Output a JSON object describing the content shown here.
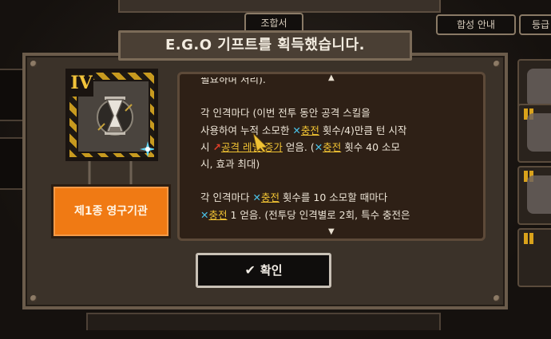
{
  "background": {
    "top_chip": "조합서",
    "synthesis_guide": "합성 안내",
    "grade_chip": "등급"
  },
  "dialog": {
    "title": "E.G.O 기프트를 획득했습니다.",
    "gift": {
      "tier": "IV",
      "name": "제1종 영구기관",
      "icon": "hourglass-icon"
    },
    "description": {
      "cut_line": "필요하며 처리).",
      "para1": {
        "line1": "각 인격마다 (이번 전투 동안 공격 스킬을",
        "line2": "사용하여 누적 소모한 ",
        "charge": "충전",
        "line2_rest": " 횟수/4)만큼 턴 시작",
        "line3_pre": "시 ",
        "attack_level_up": "공격 레벨 증가",
        "line3_mid": " 얻음. (",
        "line3_rest": " 횟수 40 소모",
        "line4": "시, 효과 최대)"
      },
      "para2": {
        "line1_pre": "각 인격마다 ",
        "line1_rest": " 횟수를 10 소모할 때마다",
        "line2_rest": " 1 얻음. (전투당 인격별로 2회, 특수 충전은"
      },
      "scroll_up": "▲",
      "scroll_down": "▼"
    },
    "confirm": "확인",
    "colors": {
      "name_button": "#f07a14",
      "keyword": "#f0c233",
      "charge_icon": "#4bc4ea"
    }
  }
}
